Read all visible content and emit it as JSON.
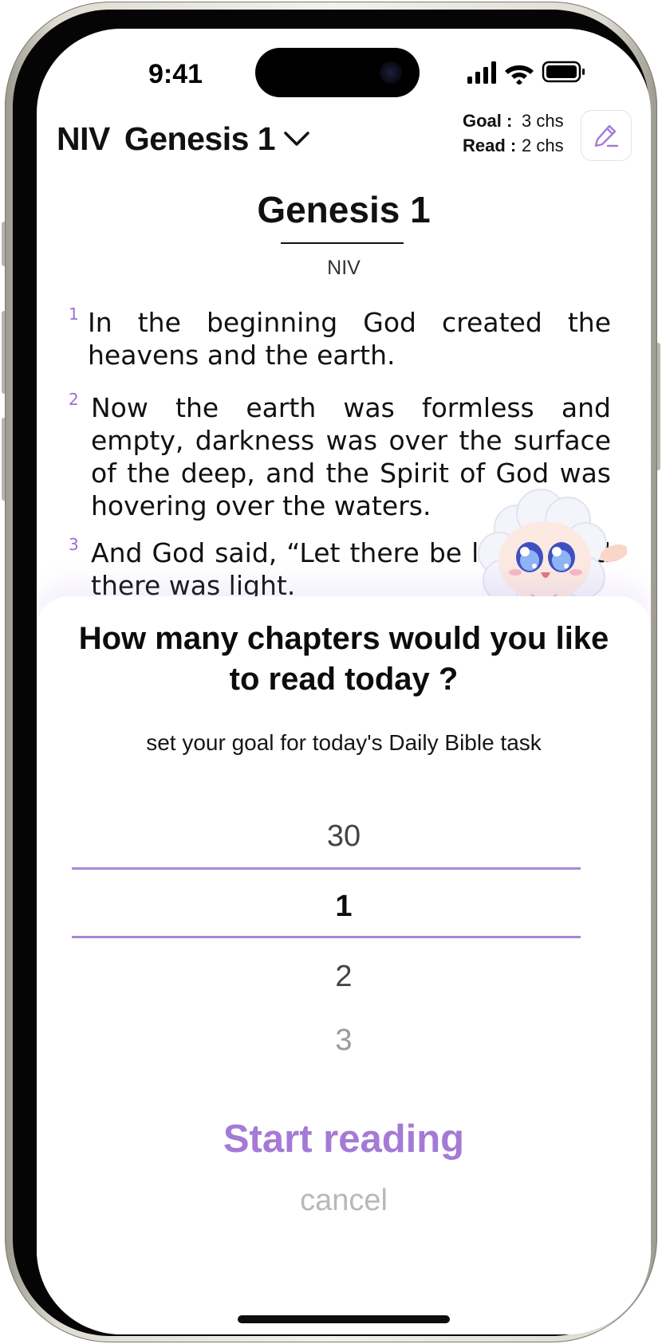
{
  "status_bar": {
    "time": "9:41"
  },
  "header": {
    "version": "NIV",
    "book_chapter": "Genesis 1",
    "goal_label": "Goal :",
    "goal_value": "3 chs",
    "read_label": "Read :",
    "read_value": "2 chs"
  },
  "reader": {
    "chapter_title": "Genesis 1",
    "version": "NIV",
    "verses": [
      {
        "number": "1",
        "text": "In the beginning God created the heavens and the earth."
      },
      {
        "number": "2",
        "text": "Now the earth was formless and empty, darkness was over the surface of the deep, and the Spirit of God was hovering over the waters."
      },
      {
        "number": "3",
        "text": "And God said, “Let there be light,” and there was light."
      }
    ]
  },
  "goal_sheet": {
    "title": "How many chapters would you like to read today ?",
    "subtitle": "set your goal for today's Daily Bible task",
    "picker": {
      "above": "30",
      "selected": "1",
      "below1": "2",
      "below2": "3"
    },
    "start_label": "Start reading",
    "cancel_label": "cancel"
  },
  "colors": {
    "accent": "#a47ad6",
    "picker_line": "#a987d8",
    "verse_number": "#9b6fd4"
  }
}
